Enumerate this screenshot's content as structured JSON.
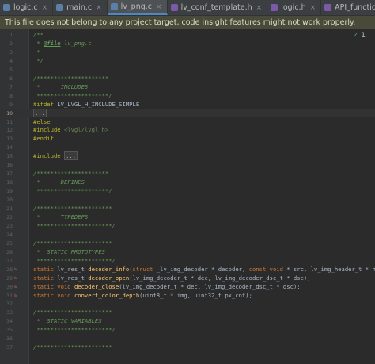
{
  "tabs": [
    {
      "label": "logic.c",
      "kind": "c",
      "active": false
    },
    {
      "label": "main.c",
      "kind": "c",
      "active": false
    },
    {
      "label": "lv_png.c",
      "kind": "c",
      "active": true
    },
    {
      "label": "lv_conf_template.h",
      "kind": "h",
      "active": false
    },
    {
      "label": "logic.h",
      "kind": "h",
      "active": false
    },
    {
      "label": "API_functions.h",
      "kind": "h",
      "active": false
    }
  ],
  "banner": "This file does not belong to any project target, code insight features might not work properly.",
  "inspection": {
    "check_icon": "✓",
    "count": "1"
  },
  "current_line": "10",
  "lines": [
    {
      "n": "1",
      "html": "<span class='cm'>/**</span>"
    },
    {
      "n": "2",
      "html": "<span class='cm'> * <span class='tag'>@file</span> lv_png.c</span>"
    },
    {
      "n": "3",
      "html": "<span class='cm'> *</span>"
    },
    {
      "n": "4",
      "html": "<span class='cm'> */</span>"
    },
    {
      "n": "5",
      "html": ""
    },
    {
      "n": "6",
      "html": "<span class='cm'>/*********************</span>"
    },
    {
      "n": "7",
      "html": "<span class='cm'> *      INCLUDES</span>"
    },
    {
      "n": "8",
      "html": "<span class='cm'> *********************/</span>"
    },
    {
      "n": "9",
      "html": "<span class='pp'>#ifdef</span> LV_LVGL_H_INCLUDE_SIMPLE"
    },
    {
      "n": "10",
      "html": "<span class='fold'>...</span>"
    },
    {
      "n": "11",
      "html": "<span class='pp'>#else</span>"
    },
    {
      "n": "12",
      "html": "<span class='pp'>#include</span> <span class='str'>&lt;lvgl/lvgl.h&gt;</span>"
    },
    {
      "n": "13",
      "html": "<span class='pp'>#endif</span>"
    },
    {
      "n": "14",
      "html": ""
    },
    {
      "n": "15",
      "html": "<span class='pp'>#include</span> <span class='fold'>...</span>"
    },
    {
      "n": "16",
      "html": ""
    },
    {
      "n": "17",
      "html": "<span class='cm'>/*********************</span>"
    },
    {
      "n": "18",
      "html": "<span class='cm'> *      DEFINES</span>"
    },
    {
      "n": "19",
      "html": "<span class='cm'> *********************/</span>"
    },
    {
      "n": "20",
      "html": ""
    },
    {
      "n": "21",
      "html": "<span class='cm'>/**********************</span>"
    },
    {
      "n": "22",
      "html": "<span class='cm'> *      TYPEDEFS</span>"
    },
    {
      "n": "23",
      "html": "<span class='cm'> **********************/</span>"
    },
    {
      "n": "24",
      "html": ""
    },
    {
      "n": "25",
      "html": "<span class='cm'>/**********************</span>"
    },
    {
      "n": "26",
      "html": "<span class='cm'> *  STATIC PROTOTYPES</span>"
    },
    {
      "n": "27",
      "html": "<span class='cm'> **********************/</span>"
    },
    {
      "n": "28",
      "mark": "≒",
      "html": "<span class='kw'>static</span> lv_res_t <span class='fn'>decoder_info</span>(<span class='kw'>struct</span> _lv_img_decoder * decoder, <span class='kw'>const void</span> * src, lv_img_header_t * hea"
    },
    {
      "n": "29",
      "mark": "≒",
      "html": "<span class='kw'>static</span> lv_res_t <span class='fn'>decoder_open</span>(lv_img_decoder_t * dec, lv_img_decoder_dsc_t * dsc);"
    },
    {
      "n": "30",
      "mark": "≒",
      "html": "<span class='kw'>static void</span> <span class='fn'>decoder_close</span>(lv_img_decoder_t * dec, lv_img_decoder_dsc_t * dsc);"
    },
    {
      "n": "31",
      "mark": "≒",
      "html": "<span class='kw'>static void</span> <span class='fn'>convert_color_depth</span>(uint8_t * img, uint32_t px_cnt);"
    },
    {
      "n": "32",
      "html": ""
    },
    {
      "n": "33",
      "html": "<span class='cm'>/**********************</span>"
    },
    {
      "n": "34",
      "html": "<span class='cm'> *  STATIC VARIABLES</span>"
    },
    {
      "n": "35",
      "html": "<span class='cm'> **********************/</span>"
    },
    {
      "n": "36",
      "html": ""
    },
    {
      "n": "37",
      "html": "<span class='cm'>/**********************</span>"
    }
  ]
}
